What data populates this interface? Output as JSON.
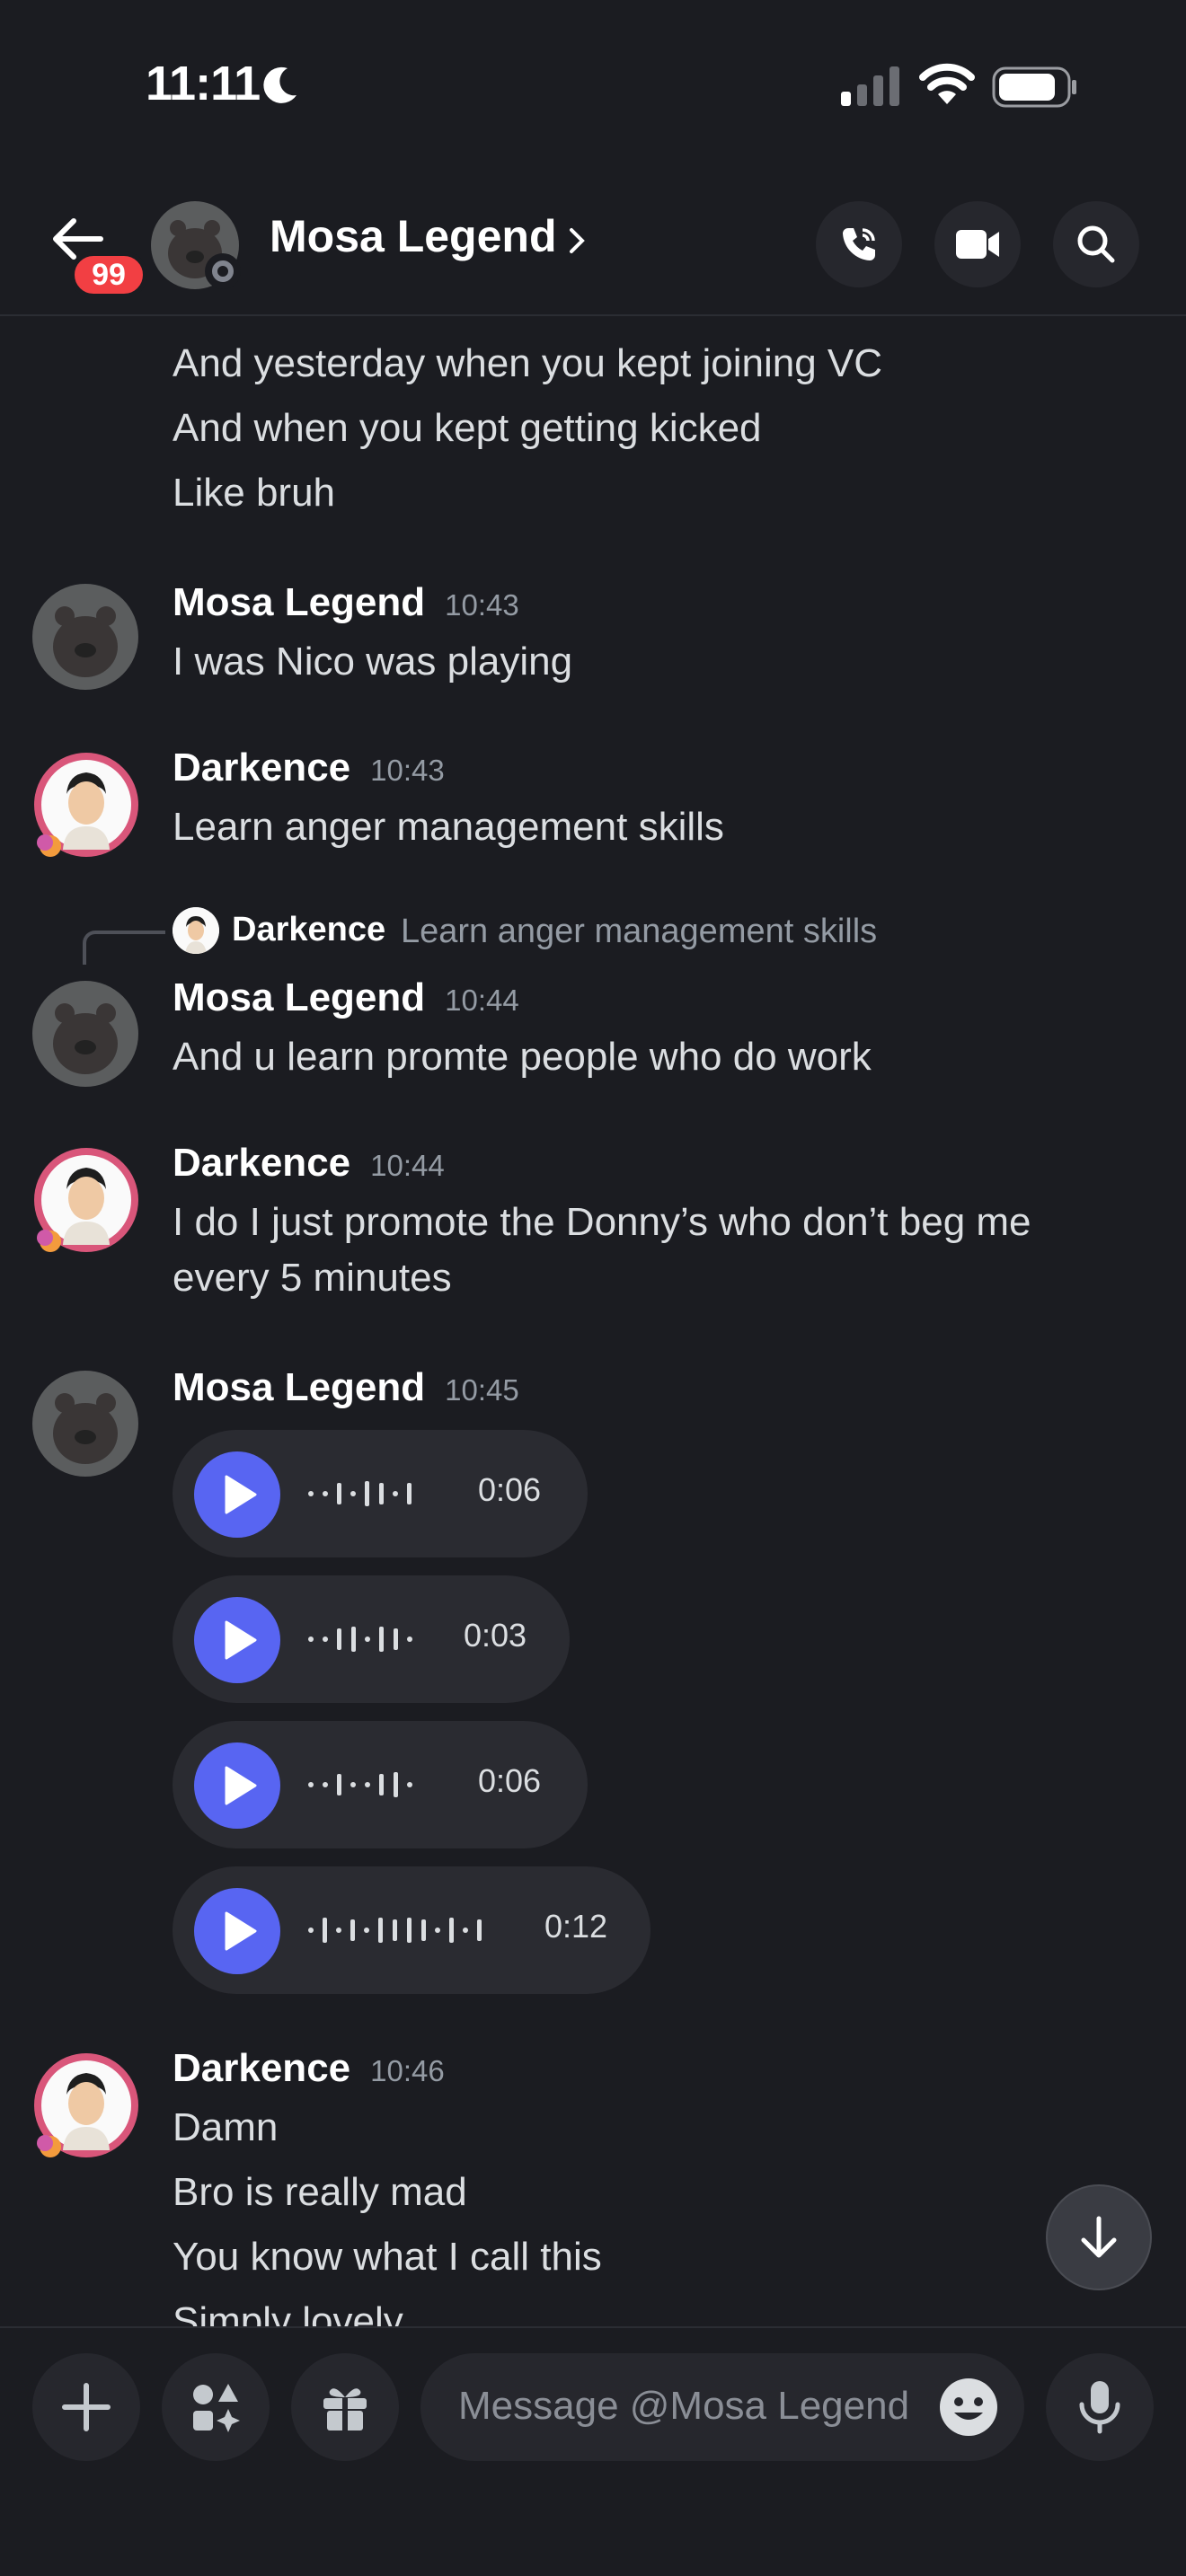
{
  "status_bar": {
    "time": "11:11"
  },
  "header": {
    "back_badge": "99",
    "contact_name": "Mosa Legend"
  },
  "messages": {
    "continued": [
      "And yesterday when you kept joining VC",
      "And when you kept getting kicked",
      "Like bruh"
    ],
    "m1": {
      "author": "Mosa Legend",
      "time": "10:43",
      "lines": [
        "I was Nico was playing"
      ]
    },
    "m2": {
      "author": "Darkence",
      "time": "10:43",
      "lines": [
        "Learn anger management skills"
      ]
    },
    "m3": {
      "reply": {
        "author": "Darkence",
        "text": "Learn anger management skills"
      },
      "author": "Mosa Legend",
      "time": "10:44",
      "lines": [
        "And u learn promte people who do work"
      ]
    },
    "m4": {
      "author": "Darkence",
      "time": "10:44",
      "lines": [
        "I do I just promote the Donny’s who don’t beg me",
        "every 5 minutes"
      ]
    },
    "m5": {
      "author": "Mosa Legend",
      "time": "10:45",
      "voice_notes": [
        {
          "duration": "0:06"
        },
        {
          "duration": "0:03"
        },
        {
          "duration": "0:06"
        },
        {
          "duration": "0:12"
        }
      ]
    },
    "m6": {
      "author": "Darkence",
      "time": "10:46",
      "lines": [
        "Damn",
        "Bro is really mad",
        "You know what I call this",
        "Simply lovely"
      ]
    }
  },
  "composer": {
    "placeholder": "Message @Mosa Legend"
  },
  "colors": {
    "accent": "#5865f2",
    "badge": "#f23f43",
    "background": "#1b1c21"
  }
}
